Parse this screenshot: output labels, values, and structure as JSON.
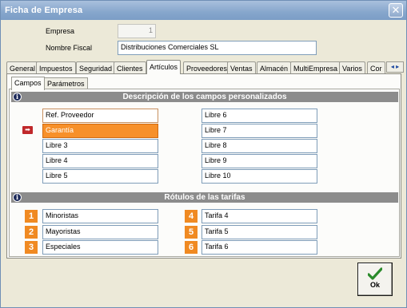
{
  "window": {
    "title": "Ficha de Empresa",
    "close_glyph": "✕"
  },
  "header": {
    "empresa_label": "Empresa",
    "empresa_value": "1",
    "nombre_label": "Nombre Fiscal",
    "nombre_value": "Distribuciones Comerciales SL"
  },
  "tabs": [
    "General",
    "Impuestos",
    "Seguridad",
    "Clientes",
    "Artículos",
    "Proveedores",
    "Ventas",
    "Almacén",
    "MultiEmpresa",
    "Varios",
    "Cor"
  ],
  "active_tab": "Artículos",
  "tab_scroll": {
    "left_glyph": "◂",
    "right_glyph": "▸"
  },
  "subtabs": [
    "Campos",
    "Parámetros"
  ],
  "active_subtab": "Campos",
  "sections": {
    "custom_fields_title": "Descripción de los campos personalizados",
    "rates_title": "Rótulos de las tarifas",
    "info_glyph": "i"
  },
  "custom_fields": {
    "left": [
      "Ref. Proveedor",
      "Garantía",
      "Libre 3",
      "Libre 4",
      "Libre 5"
    ],
    "right": [
      "Libre 6",
      "Libre 7",
      "Libre 8",
      "Libre 9",
      "Libre 10"
    ],
    "selected_index": 1,
    "pointer_glyph": "➡"
  },
  "rates": {
    "left": [
      {
        "num": "1",
        "label": "Minoristas"
      },
      {
        "num": "2",
        "label": "Mayoristas"
      },
      {
        "num": "3",
        "label": "Especiales"
      }
    ],
    "right": [
      {
        "num": "4",
        "label": "Tarifa 4"
      },
      {
        "num": "5",
        "label": "Tarifa 5"
      },
      {
        "num": "6",
        "label": "Tarifa 6"
      }
    ]
  },
  "ok_button": {
    "label": "Ok"
  },
  "colors": {
    "accent": "#f08a22",
    "section_bar": "#8c8c8c",
    "check": "#2a8a2a"
  }
}
